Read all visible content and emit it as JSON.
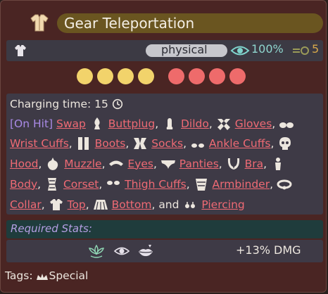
{
  "card": {
    "title": "Gear Teleportation",
    "damage_type": "physical",
    "accuracy": "100%",
    "cost": "5",
    "colors": {
      "title_bar": "#6a5520",
      "pip_yellow": "#f2d36b",
      "pip_red": "#ee6b6b",
      "link": "#ef6a74",
      "tag": "#a98ae6"
    },
    "pips": [
      "yellow",
      "yellow",
      "yellow",
      "yellow",
      "red",
      "red",
      "red",
      "red"
    ]
  },
  "effects": {
    "charging_label": "Charging time: 15",
    "on_hit_tag": "[On Hit]",
    "swap_word": "Swap",
    "items": [
      "Buttplug",
      "Dildo",
      "Gloves",
      "Wrist Cuffs",
      "Boots",
      "Socks",
      "Ankle Cuffs",
      "Hood",
      "Muzzle",
      "Eyes",
      "Panties",
      "Bra",
      "Body",
      "Corset",
      "Thigh Cuffs",
      "Armbinder",
      "Collar",
      "Top",
      "Bottom",
      "Piercing"
    ],
    "and_word": "and"
  },
  "required": {
    "title": "Required Stats:",
    "damage_bonus": "+13% DMG",
    "icons": [
      "lotus-icon",
      "eye-icon",
      "lips-icon"
    ]
  },
  "tags": {
    "label": "Tags:",
    "value": "Special"
  }
}
